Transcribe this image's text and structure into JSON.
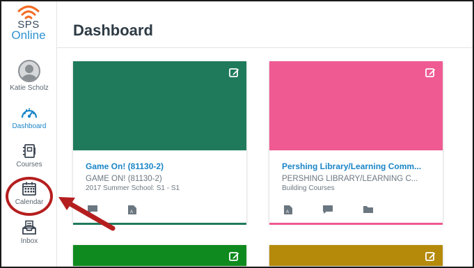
{
  "logo": {
    "line1": "SPS",
    "line2": "Online",
    "accent": "#f26b22"
  },
  "sidebar": {
    "items": [
      {
        "label": "Katie Scholz",
        "icon": "avatar-icon"
      },
      {
        "label": "Dashboard",
        "icon": "dashboard-icon",
        "active": true
      },
      {
        "label": "Courses",
        "icon": "courses-icon"
      },
      {
        "label": "Calendar",
        "icon": "calendar-icon"
      },
      {
        "label": "Inbox",
        "icon": "inbox-icon"
      }
    ]
  },
  "page": {
    "title": "Dashboard"
  },
  "cards": [
    {
      "name": "Game On! (81130-2)",
      "code": "GAME ON! (81130-2)",
      "term": "2017 Summer School: S1 - S1",
      "color": "#1f7a5c",
      "icons": [
        "announcements-icon",
        "assignments-icon"
      ]
    },
    {
      "name": "Pershing Library/Learning Comm...",
      "code": "PERSHING LIBRARY/LEARNING C...",
      "term": "Building Courses",
      "color": "#ef5a92",
      "icons": [
        "assignments-icon",
        "announcements-icon",
        "files-icon"
      ]
    },
    {
      "color": "#0f8a1e"
    },
    {
      "color": "#b58a0b"
    }
  ],
  "annotation": {
    "highlight": "calendar",
    "color": "#b51e1e"
  }
}
